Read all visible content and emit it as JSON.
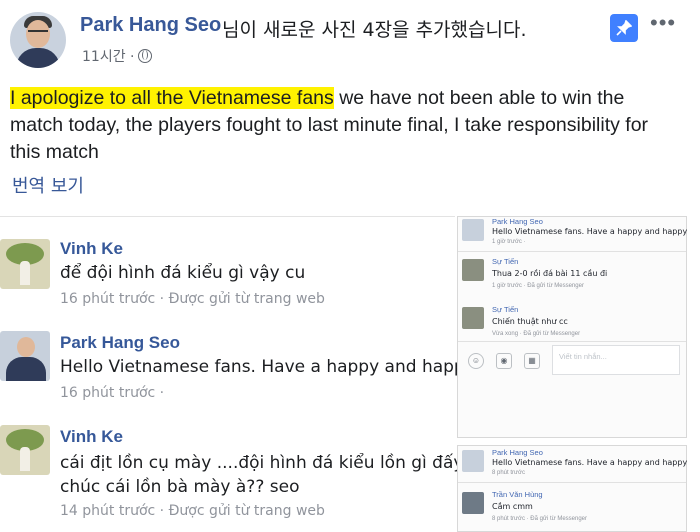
{
  "post": {
    "author": "Park Hang Seo",
    "header_suffix": "님이 새로운 사진 4장을 추가했습니다.",
    "time": "11시간 ·",
    "text_highlight": "I apologize to all the Vietnamese fans",
    "text_rest": " we have not been able to win the match today, the players fought to last minute final, I take responsibility for this match",
    "translate_link": "번역 보기",
    "pin_icon": "pin-icon",
    "more_label": "•••"
  },
  "comments": [
    {
      "name": "Vinh Ke",
      "lines": [
        "để đội hình đá kiểu gì vậy cu"
      ],
      "meta": "16 phút trước · Được gửi từ trang web"
    },
    {
      "name": "Park Hang Seo",
      "lines": [
        "Hello Vietnamese fans. Have a happy and happ"
      ],
      "meta": "16 phút trước ·"
    },
    {
      "name": "Vinh Ke",
      "lines": [
        "cái địt lồn cụ mày ....đội hình đá kiểu lồn gì đấy",
        "chúc cái lồn bà mày à?? seo"
      ],
      "meta": "14 phút trước · Được gửi từ trang web"
    }
  ],
  "messenger1": {
    "items": [
      {
        "name": "Park Hang Seo",
        "text": "Hello Vietnamese fans. Have a happy and happy",
        "time": "1 giờ trước ·"
      },
      {
        "name": "Sự Tiến",
        "text": "Thua 2-0 rồi đá bài 11 cầu đi",
        "time": "1 giờ trước · Đã gửi từ Messenger"
      },
      {
        "name": "Sự Tiến",
        "text": "Chiến thuật như cc",
        "time": "Vừa xong · Đã gửi từ Messenger"
      }
    ],
    "input_placeholder": "Viết tin nhắn..."
  },
  "messenger2": {
    "items": [
      {
        "name": "Park Hang Seo",
        "text": "Hello Vietnamese fans. Have a happy and happy",
        "time": "8 phút trước"
      },
      {
        "name": "Trần Văn Hùng",
        "text": "Cắm cmm",
        "time": "8 phút trước · Đã gửi từ Messenger"
      }
    ]
  },
  "colors": {
    "link": "#385898",
    "highlight": "#fff200",
    "pin": "#4080ff",
    "meta": "#90949c"
  }
}
